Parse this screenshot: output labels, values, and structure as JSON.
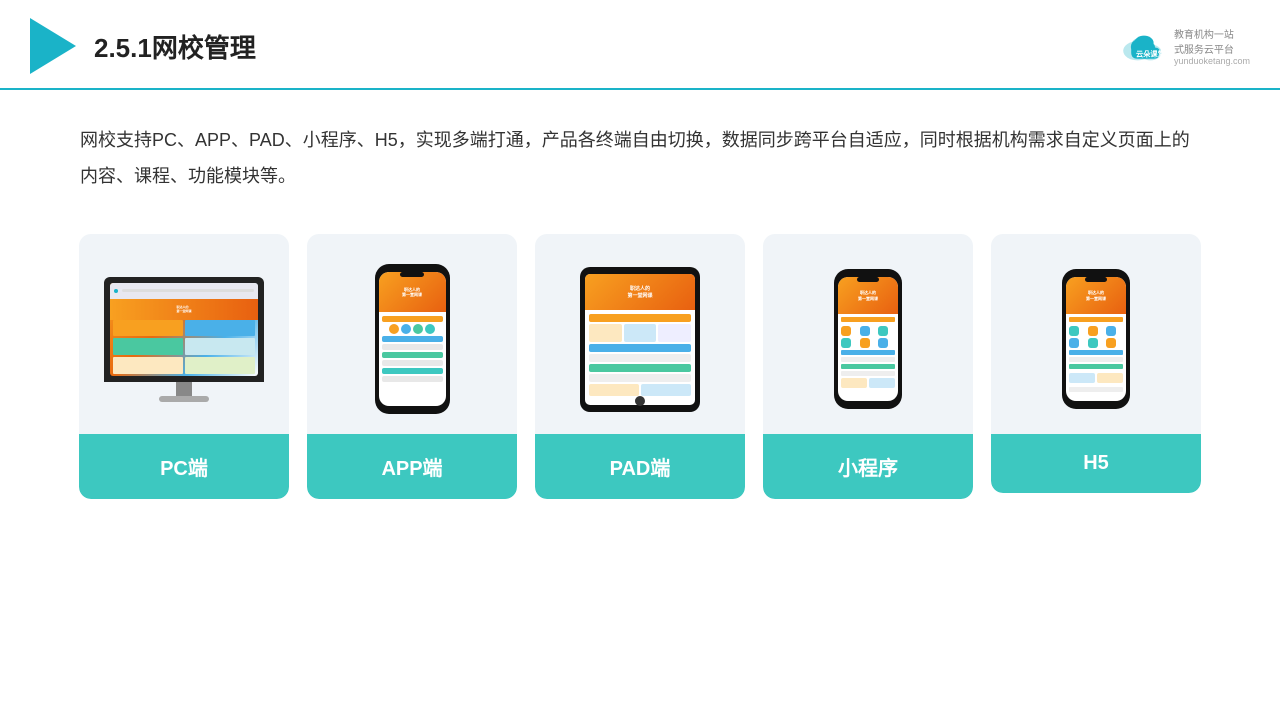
{
  "header": {
    "title": "2.5.1网校管理",
    "brand": {
      "name": "云朵课堂",
      "subtitle": "教育机构一站\n式服务云平台",
      "url": "yunduoketang.com"
    }
  },
  "description": {
    "text": "网校支持PC、APP、PAD、小程序、H5，实现多端打通，产品各终端自由切换，数据同步跨平台自适应，同时根据机构需求自定义页面上的内容、课程、功能模块等。"
  },
  "cards": [
    {
      "id": "pc",
      "label": "PC端"
    },
    {
      "id": "app",
      "label": "APP端"
    },
    {
      "id": "pad",
      "label": "PAD端"
    },
    {
      "id": "miniprogram",
      "label": "小程序"
    },
    {
      "id": "h5",
      "label": "H5"
    }
  ],
  "colors": {
    "accent": "#1ab3c8",
    "teal": "#3dc8c0",
    "orange": "#f8a020"
  }
}
